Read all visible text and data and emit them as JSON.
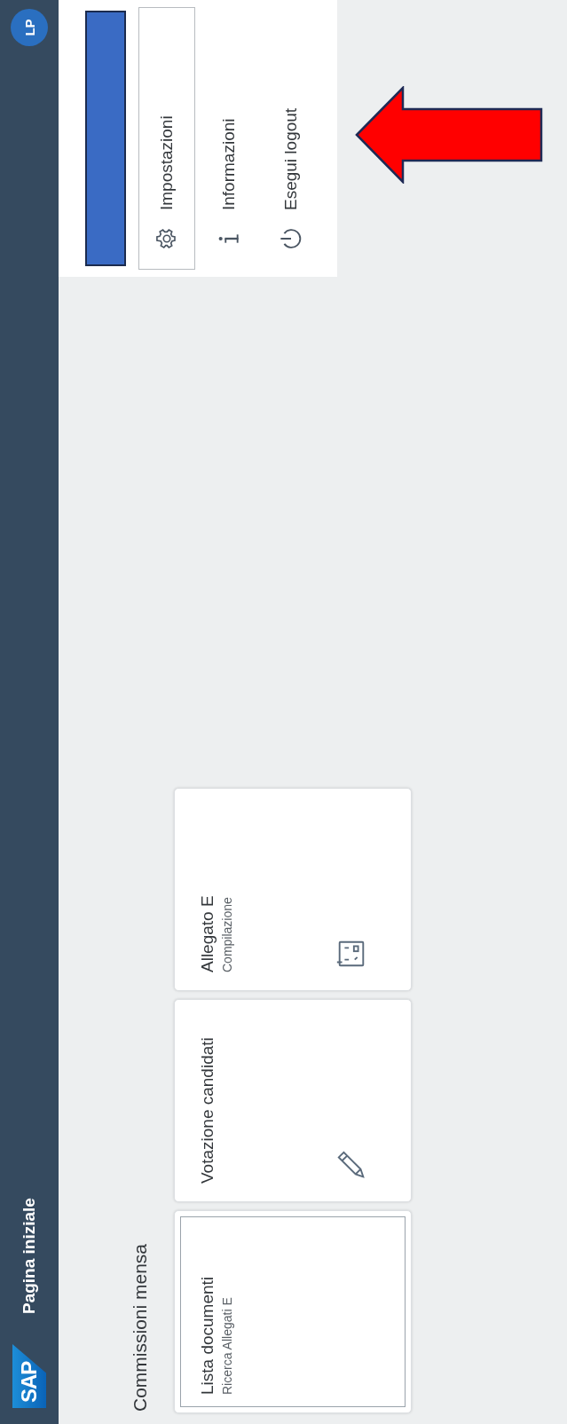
{
  "shell_bar": {
    "logo": "SAP",
    "title": "Pagina iniziale",
    "avatar": "LP"
  },
  "user_menu": {
    "header_redacted": true,
    "items": [
      {
        "label": "Impostazioni",
        "kind": "settings",
        "focused": true
      },
      {
        "label": "Informazioni",
        "kind": "info",
        "focused": false
      },
      {
        "label": "Esegui logout",
        "kind": "logout",
        "focused": false
      }
    ]
  },
  "group": {
    "title": "Commissioni mensa",
    "tiles": [
      {
        "title": "Lista documenti",
        "subtitle": "Ricerca Allegati E",
        "focused": true
      },
      {
        "title": "Votazione candidati",
        "kind": "edit",
        "focused": false
      },
      {
        "title": "Allegato E",
        "subtitle": "Compilazione",
        "kind": "form",
        "focused": false
      }
    ]
  },
  "annotation": {
    "kind": "arrow"
  }
}
